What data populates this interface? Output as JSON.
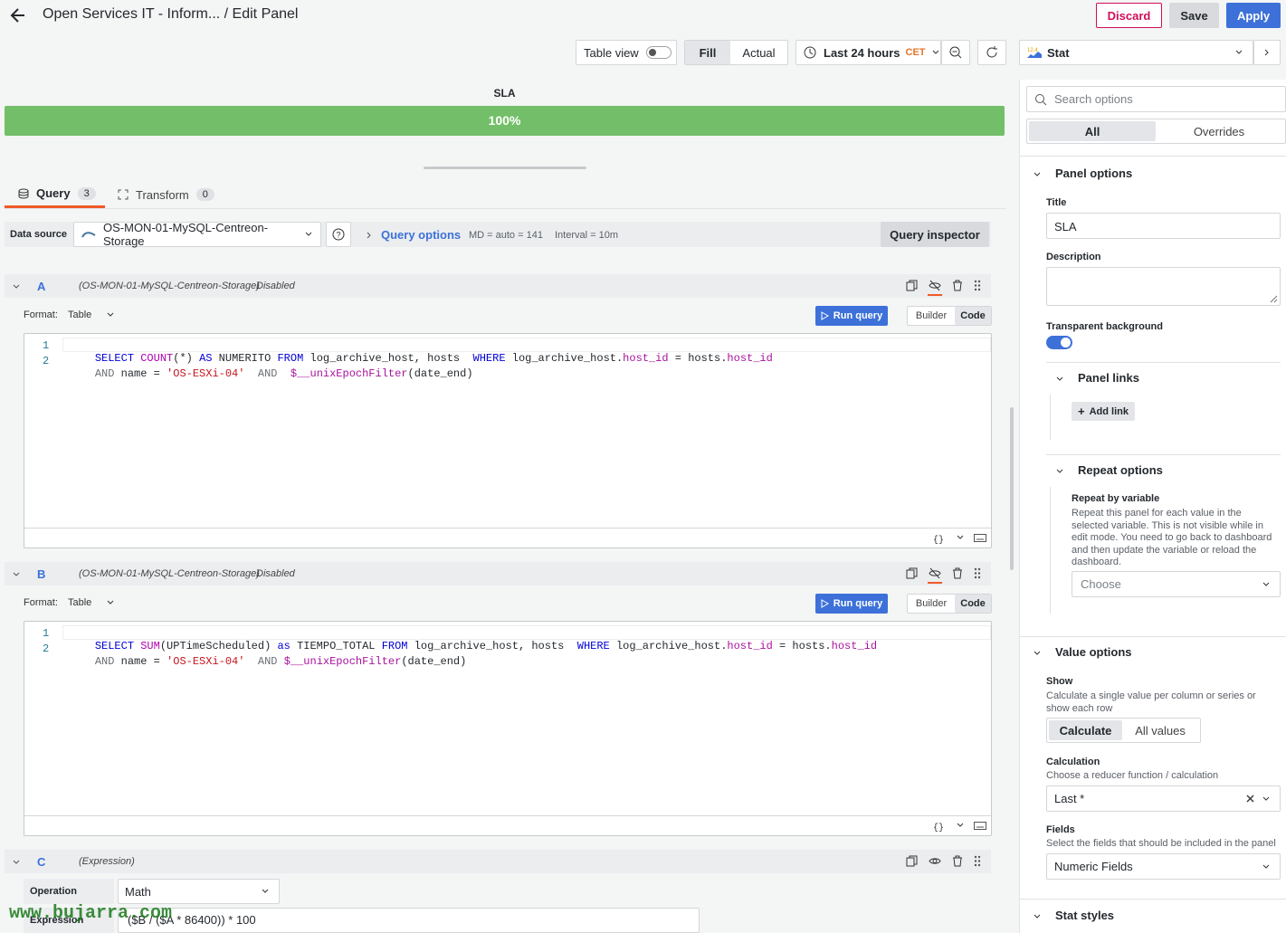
{
  "header": {
    "breadcrumb": "Open Services IT - Inform... / Edit Panel",
    "discard_label": "Discard",
    "save_label": "Save",
    "apply_label": "Apply"
  },
  "toolbar": {
    "table_view_label": "Table view",
    "fill_label": "Fill",
    "actual_label": "Actual",
    "time_range": "Last 24 hours",
    "timezone": "CET"
  },
  "visualization": {
    "name": "Stat"
  },
  "preview": {
    "title": "SLA",
    "value": "100%",
    "bar_color": "#73bf69",
    "fill_fraction": 1.0
  },
  "tabs": [
    {
      "label": "Query",
      "count": "3"
    },
    {
      "label": "Transform",
      "count": "0"
    }
  ],
  "datasource": {
    "label": "Data source",
    "name": "OS-MON-01-MySQL-Centreon-Storage",
    "query_options_label": "Query options",
    "md": "MD = auto = 141",
    "interval": "Interval = 10m",
    "inspector_label": "Query inspector"
  },
  "queries": [
    {
      "ref": "A",
      "source": "(OS-MON-01-MySQL-Centreon-Storage)",
      "status": "Disabled",
      "format_label": "Format:",
      "format_value": "Table",
      "run_label": "Run query",
      "builder_label": "Builder",
      "code_label": "Code",
      "line_numbers": [
        "1",
        "2"
      ]
    },
    {
      "ref": "B",
      "source": "(OS-MON-01-MySQL-Centreon-Storage)",
      "status": "Disabled",
      "format_label": "Format:",
      "format_value": "Table",
      "run_label": "Run query",
      "builder_label": "Builder",
      "code_label": "Code",
      "line_numbers": [
        "1",
        "2"
      ]
    },
    {
      "ref": "C",
      "source": "(Expression)",
      "operation_label": "Operation",
      "operation_value": "Math",
      "expression_label": "Expression",
      "expression_value": "($B / ($A * 86400)) * 100"
    }
  ],
  "code_a": {
    "l1": [
      "SELECT",
      "COUNT",
      "(*)",
      "AS",
      "NUMERITO",
      "FROM",
      "log_archive_host, hosts ",
      "WHERE",
      "log_archive_host.",
      "host_id",
      "=",
      "hosts.",
      "host_id"
    ],
    "l2": [
      "AND",
      "name",
      "=",
      "'OS-ESXi-04'",
      "AND",
      "$__unixEpochFilter",
      "(date_end)"
    ]
  },
  "code_b": {
    "l1": [
      "SELECT",
      "SUM",
      "(UPTimeScheduled)",
      "as",
      "TIEMPO_TOTAL",
      "FROM",
      "log_archive_host, hosts ",
      "WHERE",
      "log_archive_host.",
      "host_id",
      "=",
      "hosts.",
      "host_id"
    ],
    "l2": [
      "AND",
      "name",
      "=",
      "'OS-ESXi-04'",
      "AND",
      "$__unixEpochFilter",
      "(date_end)"
    ]
  },
  "options": {
    "search_placeholder": "Search options",
    "all_label": "All",
    "overrides_label": "Overrides",
    "panel_options": {
      "heading": "Panel options",
      "title_label": "Title",
      "title_value": "SLA",
      "description_label": "Description",
      "transparent_label": "Transparent background",
      "transparent_on": true,
      "links_heading": "Panel links",
      "add_link_label": "Add link",
      "repeat_heading": "Repeat options",
      "repeat_by_label": "Repeat by variable",
      "repeat_desc": "Repeat this panel for each value in the selected variable. This is not visible while in edit mode. You need to go back to dashboard and then update the variable or reload the dashboard.",
      "choose_placeholder": "Choose"
    },
    "value_options": {
      "heading": "Value options",
      "show_label": "Show",
      "show_desc": "Calculate a single value per column or series or show each row",
      "calculate_label": "Calculate",
      "all_values_label": "All values",
      "calc_label": "Calculation",
      "calc_desc": "Choose a reducer function / calculation",
      "calc_value": "Last *",
      "fields_label": "Fields",
      "fields_desc": "Select the fields that should be included in the panel",
      "fields_value": "Numeric Fields"
    },
    "stat_styles_heading": "Stat styles"
  },
  "watermark": "www.bujarra.com",
  "colors": {
    "primary": "#3d71d9",
    "discard": "#d10e5c",
    "sla_green": "#73bf69",
    "toggle": "#3d71d9"
  }
}
